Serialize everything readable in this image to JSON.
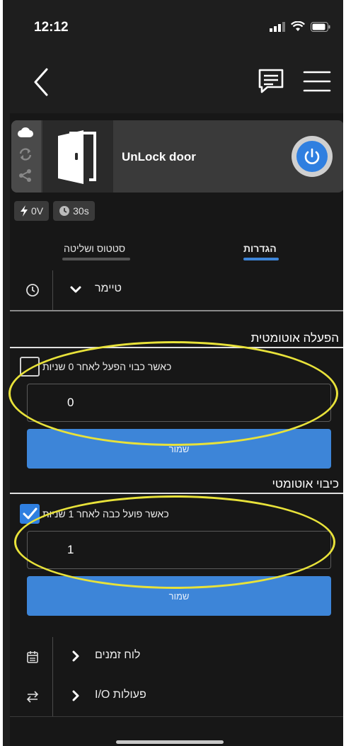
{
  "status_bar": {
    "time": "12:12"
  },
  "device": {
    "name": "UnLock door"
  },
  "chips": {
    "voltage": "0V",
    "timer": "30s"
  },
  "tabs": {
    "status_control": "סטטוס ושליטה",
    "settings": "הגדרות"
  },
  "rows": {
    "timer": "טיימר",
    "schedule": "לוח זמנים",
    "io_actions": "I/O פעולות"
  },
  "auto_on": {
    "title": "הפעלה אוטומטית",
    "checkbox_label": "כאשר כבוי הפעל לאחר 0 שניות",
    "checked": false,
    "value": "0",
    "save_label": "שמור"
  },
  "auto_off": {
    "title": "כיבוי אוטומטי",
    "checkbox_label": "כאשר פועל כבה לאחר 1 שניות",
    "checked": true,
    "value": "1",
    "save_label": "שמור"
  },
  "colors": {
    "accent": "#2f7fe0",
    "highlight": "#e8e23a",
    "background": "#171717"
  }
}
